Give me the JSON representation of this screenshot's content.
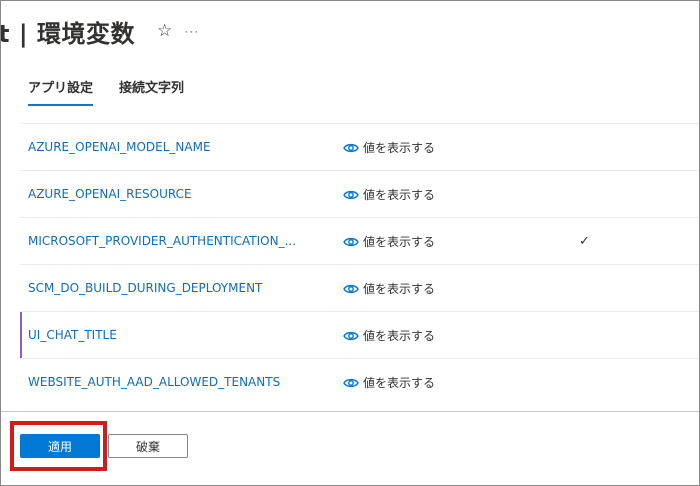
{
  "header": {
    "title": "t | 環境変数",
    "star_icon": "☆",
    "more_label": "···"
  },
  "tabs": [
    {
      "label": "アプリ設定",
      "active": true
    },
    {
      "label": "接続文字列",
      "active": false
    }
  ],
  "settings": [
    {
      "name": "AZURE_OPENAI_MODEL_NAME",
      "value_action": "値を表示する",
      "check": ""
    },
    {
      "name": "AZURE_OPENAI_RESOURCE",
      "value_action": "値を表示する",
      "check": ""
    },
    {
      "name": "MICROSOFT_PROVIDER_AUTHENTICATION_...",
      "value_action": "値を表示する",
      "check": "✓"
    },
    {
      "name": "SCM_DO_BUILD_DURING_DEPLOYMENT",
      "value_action": "値を表示する",
      "check": ""
    },
    {
      "name": "UI_CHAT_TITLE",
      "value_action": "値を表示する",
      "check": ""
    },
    {
      "name": "WEBSITE_AUTH_AAD_ALLOWED_TENANTS",
      "value_action": "値を表示する",
      "check": ""
    }
  ],
  "footer": {
    "apply_label": "適用",
    "discard_label": "破棄"
  },
  "colors": {
    "accent": "#0078d4",
    "link": "#0f6cbd",
    "highlight_box": "#d01c1c",
    "selected_row_marker": "#8764b8"
  },
  "icons": {
    "reveal": "eye-icon",
    "favorite": "star-icon",
    "more": "more-icon"
  }
}
